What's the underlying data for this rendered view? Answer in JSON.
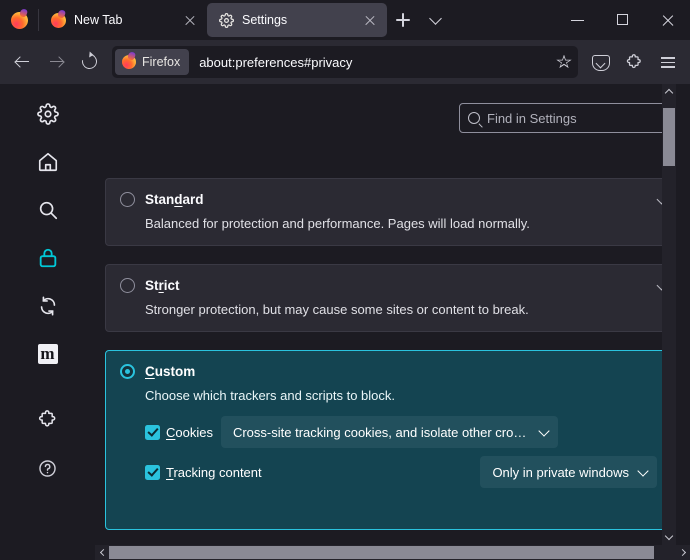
{
  "window": {
    "minimize_label": "Minimize",
    "maximize_label": "Maximize",
    "close_label": "Close"
  },
  "tabstrip": {
    "firefox_button_label": "Firefox",
    "tabs": [
      {
        "title": "New Tab",
        "favicon": "firefox-icon",
        "active": false
      },
      {
        "title": "Settings",
        "favicon": "gear-icon",
        "active": true
      }
    ],
    "new_tab_label": "+",
    "list_all_tabs_label": "List all tabs"
  },
  "navbar": {
    "back_label": "Back",
    "forward_label": "Forward",
    "reload_label": "Reload",
    "identity_label": "Firefox",
    "url": "about:preferences#privacy",
    "bookmark_label": "Bookmark this page",
    "pocket_label": "Save to Pocket",
    "extensions_label": "Extensions",
    "app_menu_label": "Open application menu"
  },
  "sidebar": {
    "items": [
      {
        "icon": "gear-icon",
        "label": "General"
      },
      {
        "icon": "home-icon",
        "label": "Home"
      },
      {
        "icon": "search-icon",
        "label": "Search"
      },
      {
        "icon": "lock-icon",
        "label": "Privacy & Security",
        "selected": true
      },
      {
        "icon": "sync-icon",
        "label": "Sync"
      },
      {
        "icon": "mozilla-m-icon",
        "label": "Mozilla Account"
      },
      {
        "icon": "extensions-icon",
        "label": "Extensions & Themes"
      },
      {
        "icon": "help-icon",
        "label": "Firefox Support"
      }
    ]
  },
  "search": {
    "placeholder": "Find in Settings",
    "value": "",
    "icon": "search-icon"
  },
  "privacy": {
    "options": [
      {
        "id": "standard",
        "title_pre": "Stan",
        "title_key": "d",
        "title_post": "ard",
        "title": "Standard",
        "description": "Balanced for protection and performance. Pages will load normally.",
        "selected": false
      },
      {
        "id": "strict",
        "title_pre": "St",
        "title_key": "r",
        "title_post": "ict",
        "title": "Strict",
        "description": "Stronger protection, but may cause some sites or content to break.",
        "selected": false
      },
      {
        "id": "custom",
        "title_pre": "",
        "title_key": "C",
        "title_post": "ustom",
        "title": "Custom",
        "description": "Choose which trackers and scripts to block.",
        "selected": true
      }
    ],
    "custom_controls": [
      {
        "id": "cookies",
        "label_pre": "",
        "label_key": "C",
        "label_post": "ookies",
        "label": "Cookies",
        "checked": true,
        "value": "Cross-site tracking cookies, and isolate other cross-site c..."
      },
      {
        "id": "tracking-content",
        "label_pre": "",
        "label_key": "T",
        "label_post": "racking content",
        "label": "Tracking content",
        "checked": true,
        "value": "Only in private windows"
      }
    ]
  },
  "colors": {
    "accent_cyan": "#2ac3de",
    "custom_panel_bg": "#144451",
    "chrome_bg": "#1c1b22",
    "navbar_bg": "#2b2a33",
    "card_bg": "#2b2a33"
  }
}
